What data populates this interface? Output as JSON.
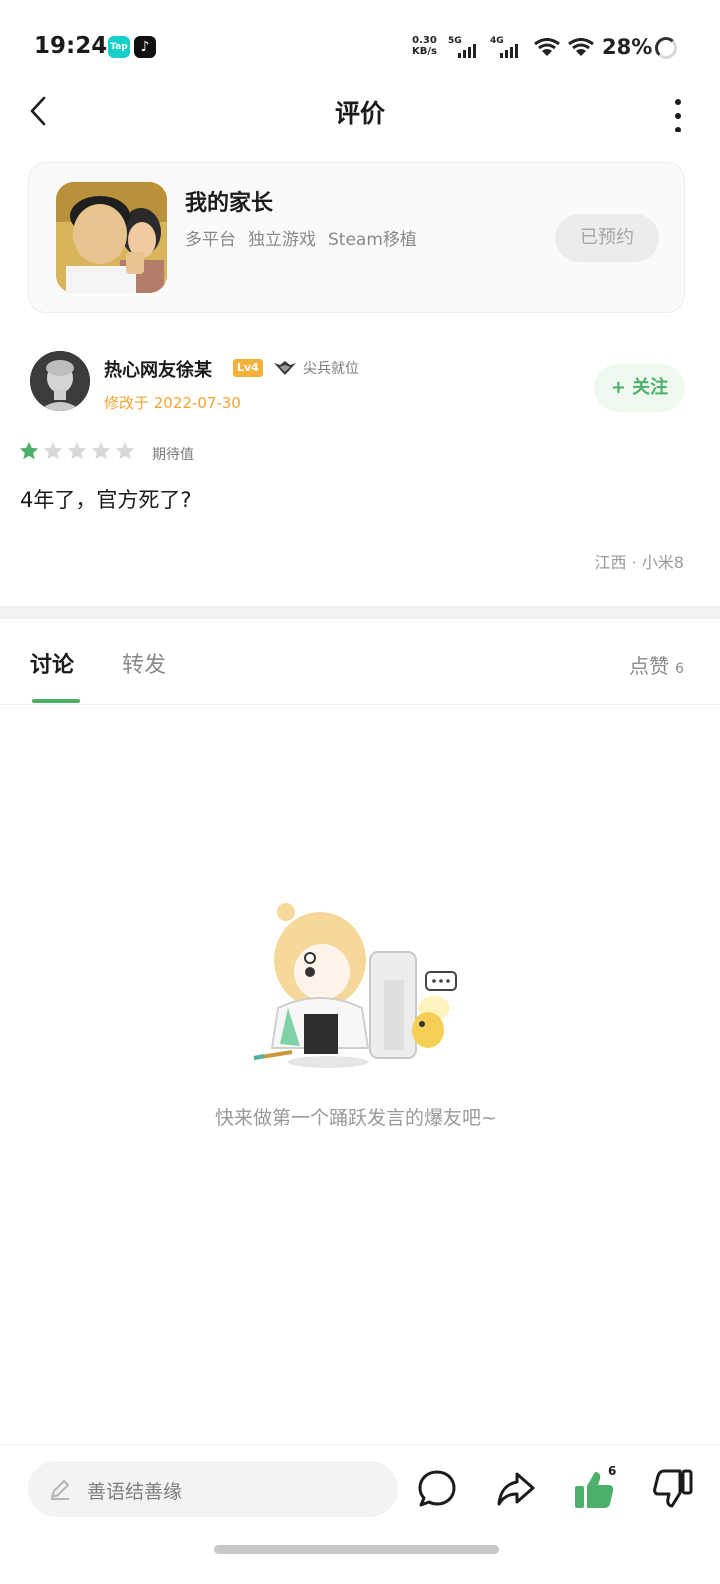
{
  "status_bar": {
    "time": "19:24",
    "app_badges": [
      "Tap",
      "♪"
    ],
    "net_speed_value": "0.30",
    "net_speed_unit": "KB/s",
    "sim1": "5G",
    "sim2": "4G",
    "battery": "28%"
  },
  "header": {
    "title": "评价",
    "back_icon": "chevron-left-icon",
    "more_icon": "vertical-dots-icon"
  },
  "game": {
    "name": "我的家长",
    "tags": [
      "多平台",
      "独立游戏",
      "Steam移植"
    ],
    "reserve_label": "已预约"
  },
  "review": {
    "user": {
      "name": "热心网友徐某",
      "level": "Lv4",
      "rank": "尖兵就位",
      "modified": "修改于 2022-07-30",
      "follow_label": "+ 关注"
    },
    "rating": {
      "value": 1,
      "max": 5,
      "label": "期待值"
    },
    "text": "4年了，官方死了?",
    "location": "江西 · 小米8"
  },
  "tabs": {
    "items": [
      {
        "label": "讨论",
        "active": true
      },
      {
        "label": "转发",
        "active": false
      }
    ],
    "likes_label": "点赞",
    "likes_count": "6"
  },
  "empty_state": {
    "message": "快来做第一个踊跃发言的爆友吧~"
  },
  "bottom_bar": {
    "input_placeholder": "善语结善缘",
    "like_count": "6",
    "icons": [
      "comment-icon",
      "share-icon",
      "thumbs-up-icon",
      "thumbs-down-icon"
    ]
  },
  "colors": {
    "accent_green": "#4caf6a",
    "date_orange": "#f0a531",
    "level_badge": "#f3b13c"
  }
}
